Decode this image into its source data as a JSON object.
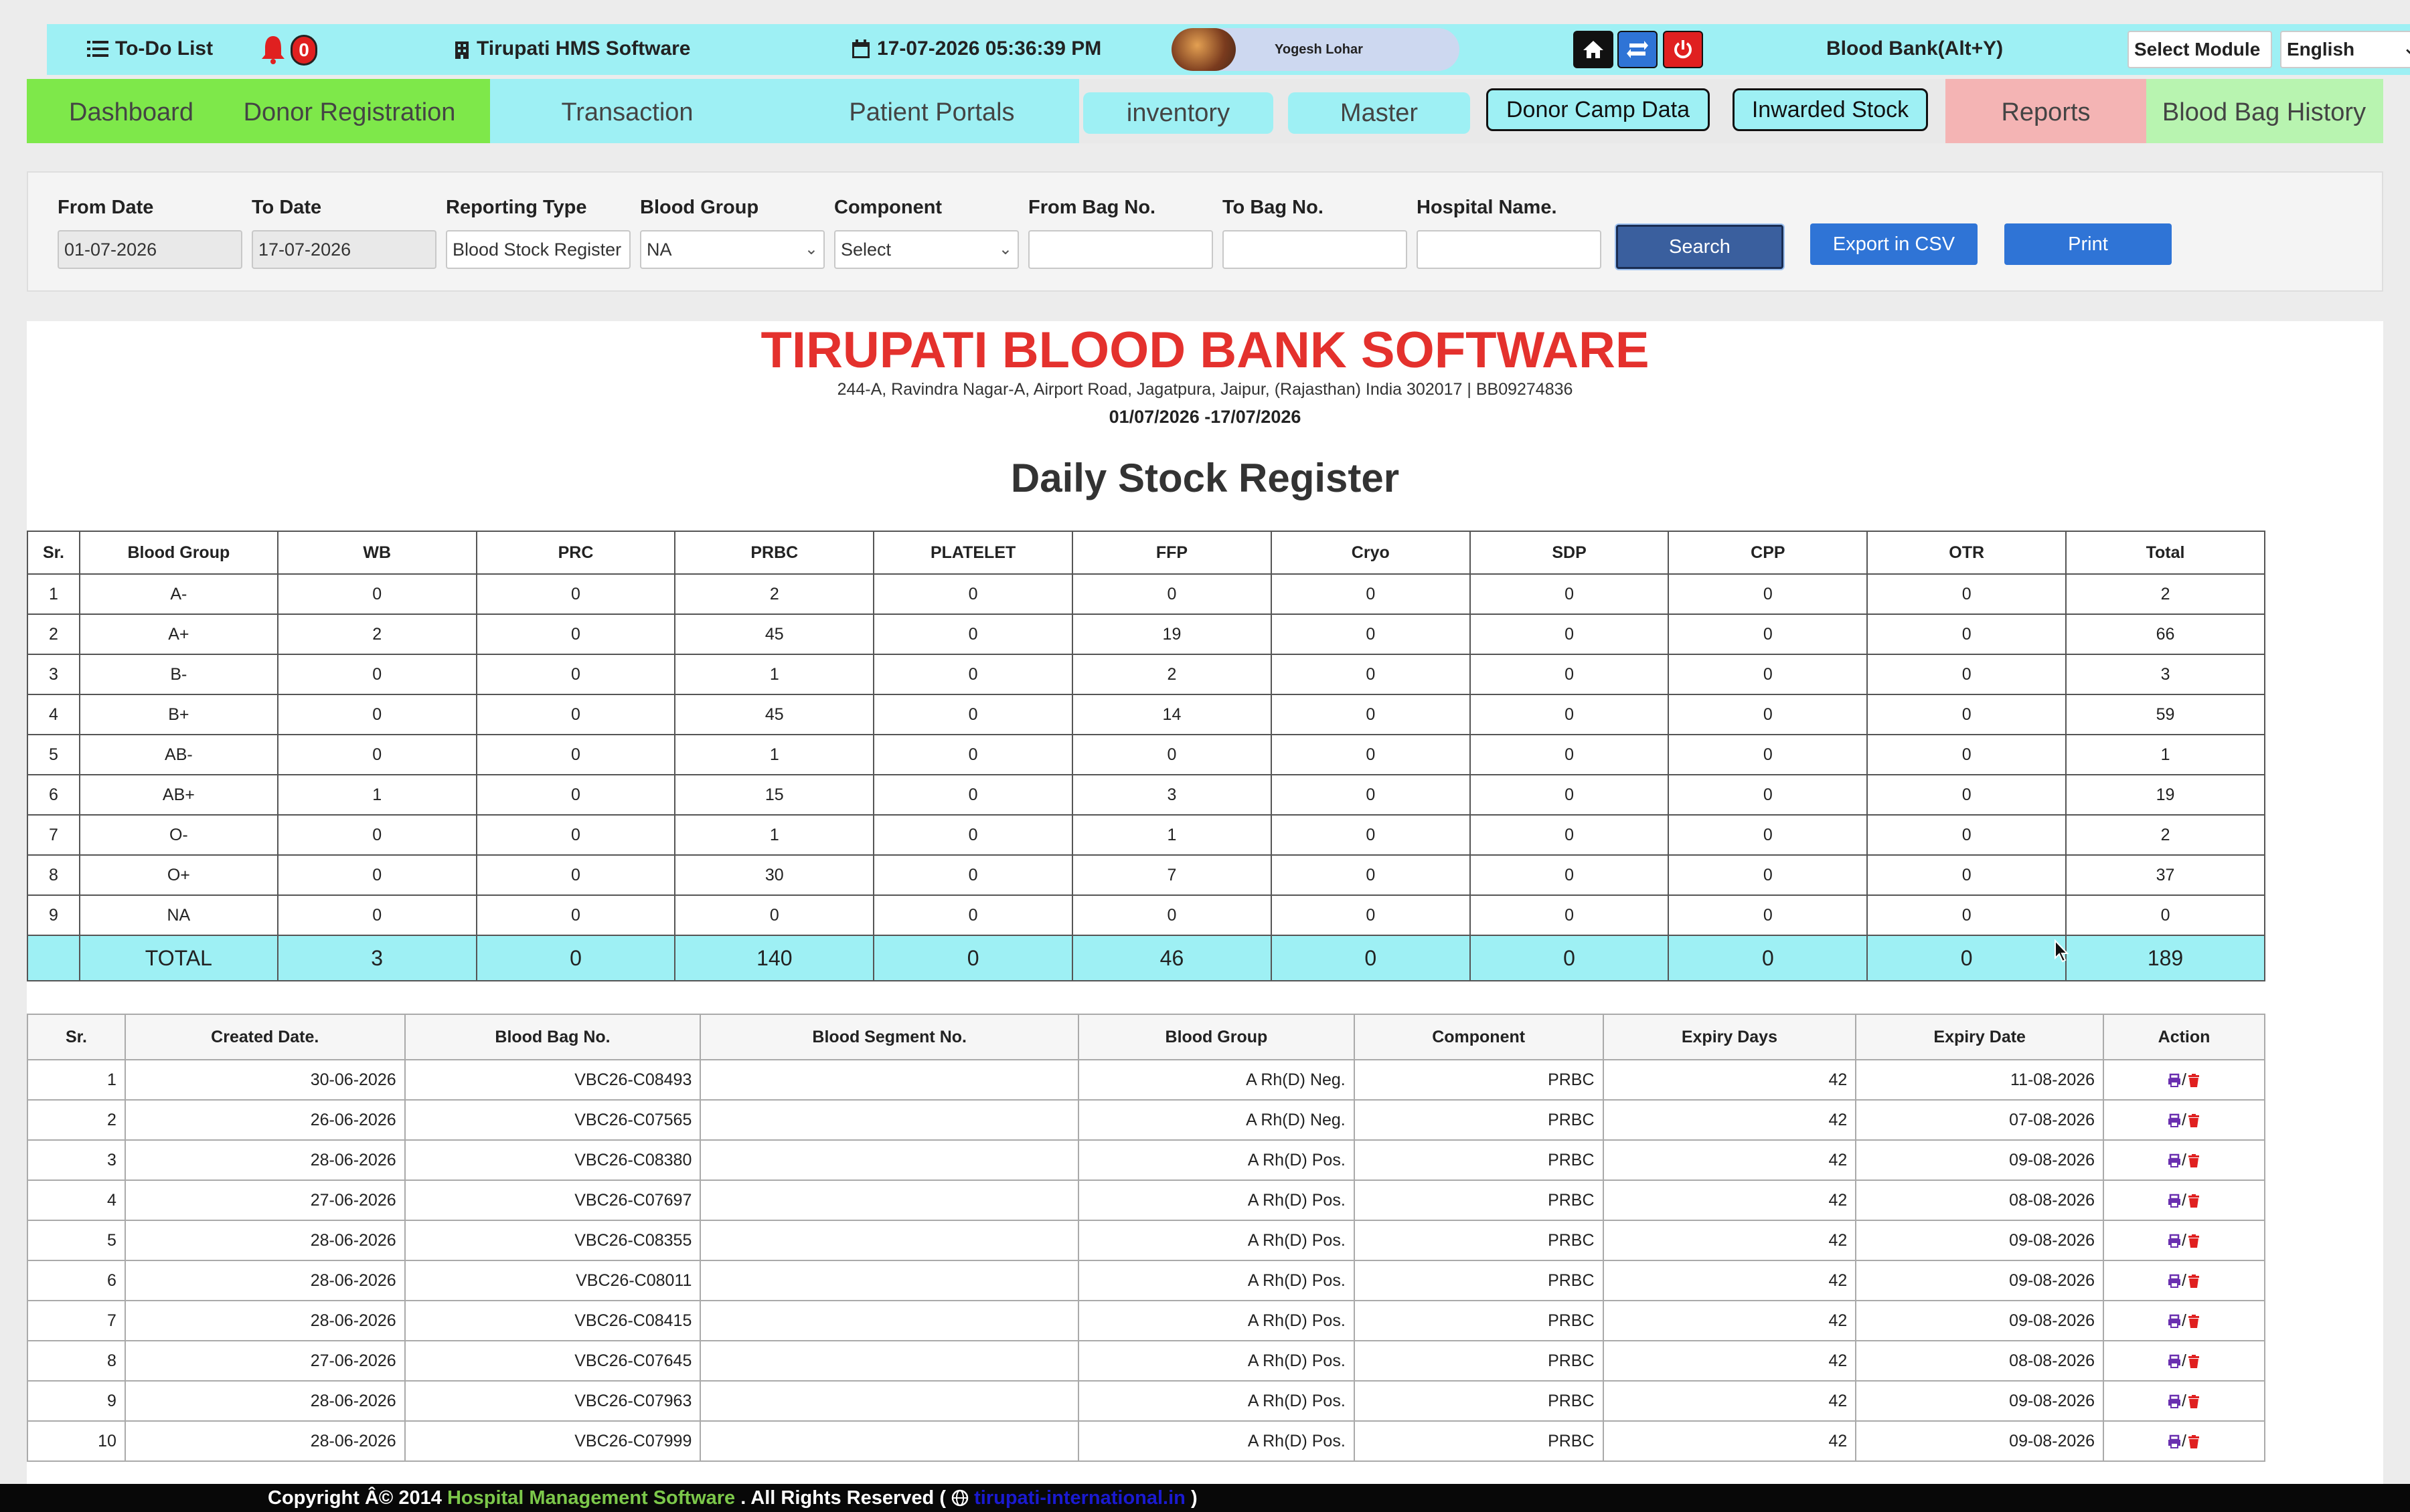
{
  "topbar": {
    "todo_label": "To-Do List",
    "notif_count": "0",
    "app_name": "Tirupati HMS Software",
    "datetime": "17-07-2026 05:36:39 PM",
    "user_name": "Yogesh Lohar",
    "module_title": "Blood Bank(Alt+Y)",
    "module_select": "Select Module",
    "language": "English"
  },
  "nav": {
    "dashboard": "Dashboard",
    "donor_registration": "Donor Registration",
    "transaction": "Transaction",
    "patient_portals": "Patient Portals",
    "inventory": "inventory",
    "master": "Master",
    "donor_camp_data": "Donor Camp Data",
    "inwarded_stock": "Inwarded Stock",
    "reports": "Reports",
    "blood_bag_history": "Blood Bag History"
  },
  "filters": {
    "from_date_label": "From Date",
    "from_date": "01-07-2026",
    "to_date_label": "To Date",
    "to_date": "17-07-2026",
    "reporting_type_label": "Reporting Type",
    "reporting_type": "Blood Stock Register",
    "blood_group_label": "Blood Group",
    "blood_group": "NA",
    "component_label": "Component",
    "component": "Select",
    "from_bag_label": "From Bag No.",
    "to_bag_label": "To Bag No.",
    "hospital_label": "Hospital Name.",
    "search": "Search",
    "export": "Export in CSV",
    "print": "Print"
  },
  "report": {
    "title": "TIRUPATI BLOOD BANK SOFTWARE",
    "address": "244-A, Ravindra Nagar-A, Airport Road, Jagatpura, Jaipur, (Rajasthan) India 302017 | BB09274836",
    "date_range": "01/07/2026 -17/07/2026",
    "heading": "Daily Stock Register"
  },
  "stock": {
    "headers": [
      "Sr.",
      "Blood Group",
      "WB",
      "PRC",
      "PRBC",
      "PLATELET",
      "FFP",
      "Cryo",
      "SDP",
      "CPP",
      "OTR",
      "Total"
    ],
    "rows": [
      [
        "1",
        "A-",
        "0",
        "0",
        "2",
        "0",
        "0",
        "0",
        "0",
        "0",
        "0",
        "2"
      ],
      [
        "2",
        "A+",
        "2",
        "0",
        "45",
        "0",
        "19",
        "0",
        "0",
        "0",
        "0",
        "66"
      ],
      [
        "3",
        "B-",
        "0",
        "0",
        "1",
        "0",
        "2",
        "0",
        "0",
        "0",
        "0",
        "3"
      ],
      [
        "4",
        "B+",
        "0",
        "0",
        "45",
        "0",
        "14",
        "0",
        "0",
        "0",
        "0",
        "59"
      ],
      [
        "5",
        "AB-",
        "0",
        "0",
        "1",
        "0",
        "0",
        "0",
        "0",
        "0",
        "0",
        "1"
      ],
      [
        "6",
        "AB+",
        "1",
        "0",
        "15",
        "0",
        "3",
        "0",
        "0",
        "0",
        "0",
        "19"
      ],
      [
        "7",
        "O-",
        "0",
        "0",
        "1",
        "0",
        "1",
        "0",
        "0",
        "0",
        "0",
        "2"
      ],
      [
        "8",
        "O+",
        "0",
        "0",
        "30",
        "0",
        "7",
        "0",
        "0",
        "0",
        "0",
        "37"
      ],
      [
        "9",
        "NA",
        "0",
        "0",
        "0",
        "0",
        "0",
        "0",
        "0",
        "0",
        "0",
        "0"
      ]
    ],
    "total": [
      "",
      "TOTAL",
      "3",
      "0",
      "140",
      "0",
      "46",
      "0",
      "0",
      "0",
      "0",
      "189"
    ]
  },
  "bags": {
    "headers": [
      "Sr.",
      "Created Date.",
      "Blood Bag No.",
      "Blood Segment No.",
      "Blood Group",
      "Component",
      "Expiry Days",
      "Expiry Date",
      "Action"
    ],
    "rows": [
      [
        "1",
        "30-06-2026",
        "VBC26-C08493",
        "",
        "A Rh(D) Neg.",
        "PRBC",
        "42",
        "11-08-2026"
      ],
      [
        "2",
        "26-06-2026",
        "VBC26-C07565",
        "",
        "A Rh(D) Neg.",
        "PRBC",
        "42",
        "07-08-2026"
      ],
      [
        "3",
        "28-06-2026",
        "VBC26-C08380",
        "",
        "A Rh(D) Pos.",
        "PRBC",
        "42",
        "09-08-2026"
      ],
      [
        "4",
        "27-06-2026",
        "VBC26-C07697",
        "",
        "A Rh(D) Pos.",
        "PRBC",
        "42",
        "08-08-2026"
      ],
      [
        "5",
        "28-06-2026",
        "VBC26-C08355",
        "",
        "A Rh(D) Pos.",
        "PRBC",
        "42",
        "09-08-2026"
      ],
      [
        "6",
        "28-06-2026",
        "VBC26-C08011",
        "",
        "A Rh(D) Pos.",
        "PRBC",
        "42",
        "09-08-2026"
      ],
      [
        "7",
        "28-06-2026",
        "VBC26-C08415",
        "",
        "A Rh(D) Pos.",
        "PRBC",
        "42",
        "09-08-2026"
      ],
      [
        "8",
        "27-06-2026",
        "VBC26-C07645",
        "",
        "A Rh(D) Pos.",
        "PRBC",
        "42",
        "08-08-2026"
      ],
      [
        "9",
        "28-06-2026",
        "VBC26-C07963",
        "",
        "A Rh(D) Pos.",
        "PRBC",
        "42",
        "09-08-2026"
      ],
      [
        "10",
        "28-06-2026",
        "VBC26-C07999",
        "",
        "A Rh(D) Pos.",
        "PRBC",
        "42",
        "09-08-2026"
      ]
    ],
    "action_separator": "/"
  },
  "footer": {
    "copyright": "Copyright Â© 2014",
    "software": "Hospital Management Software",
    "rights": ". All Rights Reserved (",
    "link": "tirupati-international.in",
    "close": ")"
  },
  "colors": {
    "topbar_bg": "#9ef0f4",
    "nav_green": "#7ee84a",
    "nav_cyan": "#9ef0f4",
    "nav_pink": "#f4b4b4",
    "button_blue": "#2f74d6",
    "search_blue": "#3a5f9e",
    "title_red": "#e4312d"
  }
}
